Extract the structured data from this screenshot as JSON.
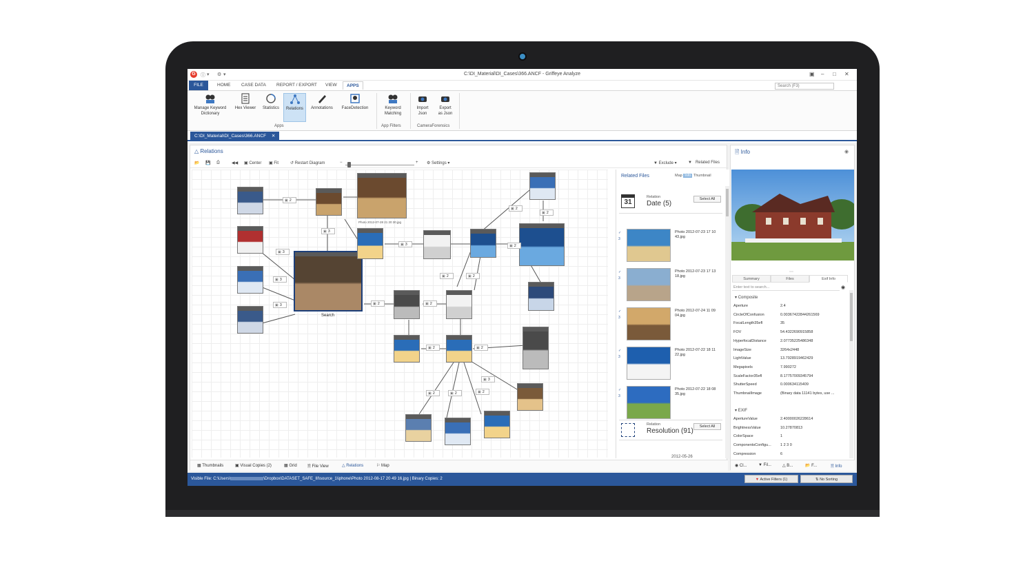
{
  "window": {
    "title": "C:\\DI_Material\\DI_Cases\\366.ANCF - Griffeye Analyze",
    "search_placeholder": "Search (F3)"
  },
  "ribbon_tabs": [
    "FILE",
    "HOME",
    "CASE DATA",
    "REPORT / EXPORT",
    "VIEW",
    "APPS"
  ],
  "ribbon": {
    "buttons": [
      "Manage Keyword\nDictionary",
      "Hex Viewer",
      "Statistics",
      "Relations",
      "Annotations",
      "FaceDetection",
      "Keyword\nMatching",
      "Import\nJson",
      "Export\nas Json"
    ],
    "groups": [
      "Apps",
      "App Filters",
      "CameraForensics"
    ]
  },
  "doc_tab": "C:\\DI_Material\\DI_Cases\\366.ANCF",
  "relations": {
    "title": "Relations",
    "toolbar": {
      "center": "Center",
      "fit": "Fit",
      "restart": "Restart Diagram",
      "settings": "Settings",
      "exclude": "Exclude",
      "related_files": "Related Files"
    },
    "captions": {
      "photo_top": "Photo 2012-07-28 21 20 30.jpg",
      "search": "Search"
    },
    "badges": [
      "2",
      "3",
      "3",
      "3",
      "3",
      "2",
      "3",
      "2",
      "2",
      "2",
      "2",
      "2",
      "2",
      "2",
      "3",
      "2",
      "2",
      "2",
      "2"
    ]
  },
  "bottom_tabs": [
    "Thumbnails",
    "Visual Copies (2)",
    "Grid",
    "File View",
    "Relations",
    "Map"
  ],
  "related_files": {
    "title": "Related Files",
    "views": [
      "Map",
      "Info",
      "Thumbnail"
    ],
    "group1": {
      "small": "Relation",
      "big": "Date (5)",
      "select_all": "Select All",
      "cal_day": "31"
    },
    "items": [
      {
        "name": "Photo 2012-07-23 17 10 43.jpg",
        "check": "3"
      },
      {
        "name": "Photo 2012-07-23 17 13 18.jpg",
        "check": "3"
      },
      {
        "name": "Photo 2012-07-24 11 09 04.jpg",
        "check": "3"
      },
      {
        "name": "Photo 2012-07-22 18 11 22.jpg",
        "check": "3"
      },
      {
        "name": "Photo 2012-07-22 18 08 35.jpg",
        "check": "3"
      }
    ],
    "group2": {
      "small": "Relation",
      "big": "Resolution (91)",
      "select_all": "Select All"
    },
    "last_date": "2012-05-26"
  },
  "info": {
    "title": "Info",
    "tabs": [
      "Summary",
      "Files",
      "Exif Info"
    ],
    "search_placeholder": "Enter text to search...",
    "composite_label": "Composite",
    "composite": [
      [
        "Aperture",
        "2.4"
      ],
      [
        "CircleOfConfusion",
        "0.00367422844261569"
      ],
      [
        "FocalLength35efl",
        "35"
      ],
      [
        "FOV",
        "54.4322690915858"
      ],
      [
        "HyperfocalDistance",
        "2.07735225486348"
      ],
      [
        "ImageSize",
        "3264x2448"
      ],
      [
        "LightValue",
        "13.7928919462429"
      ],
      [
        "Megapixels",
        "7.990272"
      ],
      [
        "ScaleFactor35efl",
        "8.17757009345794"
      ],
      [
        "ShutterSpeed",
        "0.000634115409"
      ],
      [
        "ThumbnailImage",
        "(Binary data 11141 bytes, use ..."
      ]
    ],
    "exif_label": "EXIF",
    "exif": [
      [
        "ApertureValue",
        "2.40000026228614"
      ],
      [
        "BrightnessValue",
        "10.27870813"
      ],
      [
        "ColorSpace",
        "1"
      ],
      [
        "ComponentsConfigu...",
        "1 2 3 0"
      ],
      [
        "Compression",
        "6"
      ]
    ],
    "bottom_tabs": [
      "Cl...",
      "Fil...",
      "B...",
      "F...",
      "Info"
    ]
  },
  "status": {
    "visible_file": "Visible File: C:\\Users\\",
    "path_rest": "\\Dropbox\\DATASET_SAFE_III\\source_1\\iphone\\Photo 2012-08-17 20 49 16.jpg | Binary Copies: 2",
    "active_filters": "Active Filters (1)",
    "no_sorting": "No Sorting"
  },
  "colors": {
    "accent": "#2b579a",
    "laptop": "#1f1f21",
    "selected": "#cde2f5"
  }
}
